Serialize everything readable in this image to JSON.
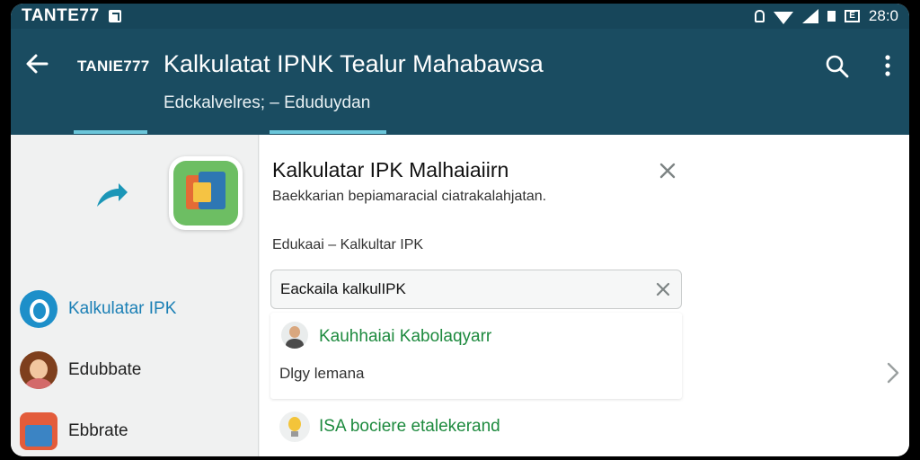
{
  "statusbar": {
    "carrier": "TANTE77",
    "time": "28:0",
    "battery_label": "E"
  },
  "appbar": {
    "tag": "TANIE777",
    "title": "Kalkulatat IPNK Tealur Mahabawsa",
    "subtitle": "Edckalvelres; – Eduduydan",
    "colors": {
      "background": "#1a4c61",
      "status": "#17465a",
      "indicator": "#6bc6da"
    },
    "icons": [
      "arrow-back-icon",
      "search-icon",
      "more-vert-icon"
    ]
  },
  "sidebar": {
    "items": [
      {
        "label": "Kalkulatar IPK",
        "icon": "app-logo-icon"
      },
      {
        "label": "Edubbate",
        "icon": "avatar-icon"
      },
      {
        "label": "Ebbrate",
        "icon": "app-icon"
      }
    ]
  },
  "card": {
    "title": "Kalkulatar IPK Malhaiaiirn",
    "subtitle": "Baekkarian bepiamaracial ciatrakalahjatan.",
    "category": "Edukaai – Kalkultar IPK",
    "search": {
      "value": "Eackaila kalkulIPK",
      "placeholder": ""
    },
    "results": [
      {
        "name": "Kauhhaiai Kabolaqyarr",
        "meta": "Dlgy lemana"
      },
      {
        "name": "ISA bociere etalekerand"
      }
    ],
    "accent_color": "#1d8a3e"
  }
}
